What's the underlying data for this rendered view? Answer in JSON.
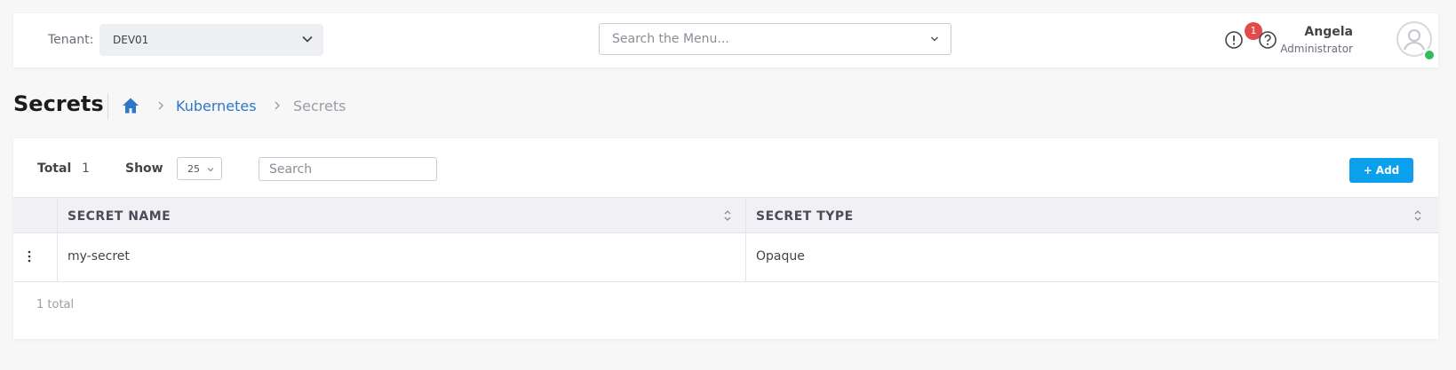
{
  "header": {
    "tenant_label": "Tenant:",
    "tenant_value": "DEV01",
    "menu_search_placeholder": "Search the Menu...",
    "notification_count": "1",
    "user_name": "Angela",
    "user_role": "Administrator"
  },
  "page": {
    "title": "Secrets",
    "breadcrumb": {
      "home_icon": "home-icon",
      "items": [
        "Kubernetes",
        "Secrets"
      ]
    }
  },
  "toolbar": {
    "total_label": "Total",
    "total_value": "1",
    "show_label": "Show",
    "page_size": "25",
    "search_placeholder": "Search",
    "add_label": "Add"
  },
  "table": {
    "columns": [
      "SECRET NAME",
      "SECRET TYPE"
    ],
    "rows": [
      {
        "name": "my-secret",
        "type": "Opaque"
      }
    ],
    "footer": "1 total"
  },
  "colors": {
    "accent": "#0aa0ec",
    "link": "#2d76c9",
    "badge": "#e24b4b",
    "online": "#2ebf5b"
  }
}
